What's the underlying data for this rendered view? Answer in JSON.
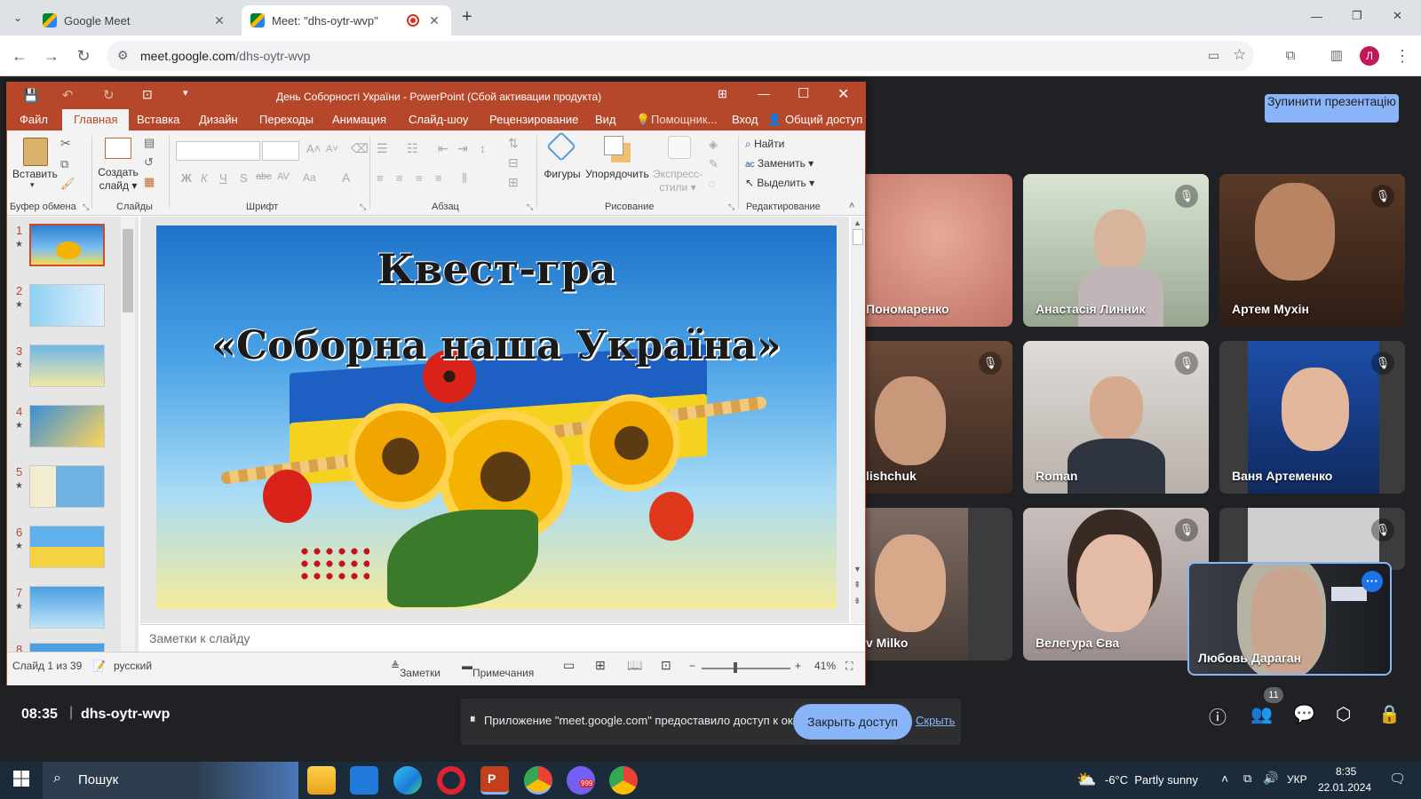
{
  "browser": {
    "tabs": [
      {
        "title": "Google Meet",
        "close": "✕"
      },
      {
        "title": "Meet: \"dhs-oytr-wvp\"",
        "close": "✕"
      }
    ],
    "new_tab": "+",
    "window_controls": [
      "—",
      "❐",
      "✕"
    ],
    "url_host": "meet.google.com",
    "url_path": "/dhs-oytr-wvp",
    "profile_initial": "Л"
  },
  "powerpoint": {
    "title": "День Соборності України - PowerPoint (Сбой активации продукта)",
    "ribbon_tabs": [
      "Файл",
      "Главная",
      "Вставка",
      "Дизайн",
      "Переходы",
      "Анимация",
      "Слайд-шоу",
      "Рецензирование",
      "Вид"
    ],
    "helper": "Помощник...",
    "login": "Вход",
    "share": "Общий доступ",
    "buttons": {
      "paste": "Вставить",
      "new_slide_1": "Создать",
      "new_slide_2": "слайд",
      "shapes": "Фигуры",
      "arrange": "Упорядочить",
      "quick_styles_1": "Экспресс-",
      "quick_styles_2": "стили",
      "find": "Найти",
      "replace": "Заменить",
      "select": "Выделить"
    },
    "groups": [
      "Буфер обмена",
      "Слайды",
      "Шрифт",
      "Абзац",
      "Рисование",
      "Редактирование"
    ],
    "slide_numbers": [
      "1",
      "2",
      "3",
      "4",
      "5",
      "6",
      "7",
      "8"
    ],
    "slide": {
      "line1": "Квест-гра",
      "line2": "«Соборна наша Україна»"
    },
    "notes_placeholder": "Заметки к слайду",
    "status": {
      "slide_of": "Слайд 1 из 39",
      "language": "русский",
      "notes": "Заметки",
      "comments": "Примечания",
      "zoom": "41%"
    }
  },
  "meet": {
    "stop_presenting": "Зупинити презентацію",
    "participants": [
      {
        "name": "Пономаренко"
      },
      {
        "name": "Анастасія Линник"
      },
      {
        "name": "Артем Мухін"
      },
      {
        "name": "lishchuk"
      },
      {
        "name": "Roman"
      },
      {
        "name": "Ваня Артеменко"
      },
      {
        "name": "v Milko"
      },
      {
        "name": "Велегура Єва"
      },
      {
        "name": ""
      }
    ],
    "self_name": "Любовь Дараган",
    "time": "08:35",
    "meeting_code": "dhs-oytr-wvp",
    "participant_count": "11",
    "share_notice": "Приложение \"meet.google.com\" предоставило доступ к окну.",
    "stop_sharing": "Закрыть доступ",
    "hide": "Скрыть"
  },
  "taskbar": {
    "search": "Пошук",
    "weather": "-6°C  Partly sunny",
    "lang": "УКР",
    "clock_time": "8:35",
    "clock_date": "22.01.2024",
    "badge": "999"
  }
}
